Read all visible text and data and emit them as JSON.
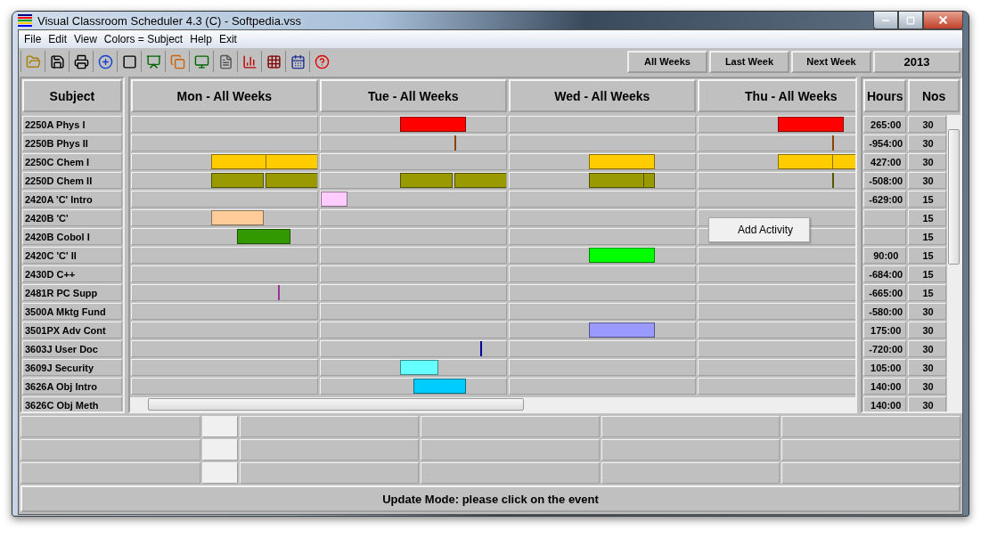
{
  "window": {
    "title": "Visual Classroom Scheduler 4.3 (C) - Softpedia.vss"
  },
  "menu": [
    "File",
    "Edit",
    "View",
    "Colors = Subject",
    "Help",
    "Exit"
  ],
  "week_buttons": [
    "All Weeks",
    "Last Week",
    "Next Week"
  ],
  "year": "2013",
  "columns": {
    "subject": "Subject",
    "hours": "Hours",
    "nos": "Nos"
  },
  "days": [
    "Mon - All Weeks",
    "Tue - All Weeks",
    "Wed - All Weeks",
    "Thu - All Weeks"
  ],
  "subjects": [
    {
      "name": "2250A Phys I",
      "hours": "265:00",
      "nos": "30",
      "activities": [
        {
          "color": "#ff0000"
        },
        {
          "color": "#ff0000"
        }
      ]
    },
    {
      "name": "2250B Phys II",
      "hours": "-954:00",
      "nos": "30",
      "activities": [
        {
          "color": "#884400"
        },
        {
          "color": "#884400"
        }
      ]
    },
    {
      "name": "2250C Chem I",
      "hours": "427:00",
      "nos": "30",
      "activities": [
        {
          "color": "#ffcc00"
        },
        {
          "color": "#ffcc00"
        },
        {
          "color": "#ffcc00"
        },
        {
          "color": "#ffcc00"
        },
        {
          "color": "#ffcc00"
        }
      ]
    },
    {
      "name": "2250D Chem II",
      "hours": "-508:00",
      "nos": "30",
      "activities": [
        {
          "color": "#999900"
        },
        {
          "color": "#999900"
        },
        {
          "color": "#999900"
        },
        {
          "color": "#999900"
        },
        {
          "color": "#999900"
        },
        {
          "color": "#999900"
        },
        {
          "color": "#555500"
        }
      ]
    },
    {
      "name": "2420A 'C' Intro",
      "hours": "-629:00",
      "nos": "15",
      "activities": [
        {
          "color": "#ffccff"
        }
      ]
    },
    {
      "name": "2420B 'C'",
      "nos": "15",
      "activities": [
        {
          "color": "#ffcc99"
        }
      ]
    },
    {
      "name": "2420B Cobol I",
      "nos": "15",
      "activities": [
        {
          "color": "#339900"
        }
      ]
    },
    {
      "name": "2420C 'C' II",
      "hours": "90:00",
      "nos": "15",
      "activities": [
        {
          "color": "#00ff00"
        }
      ]
    },
    {
      "name": "2430D C++",
      "hours": "-684:00",
      "nos": "15"
    },
    {
      "name": "2481R PC Supp",
      "hours": "-665:00",
      "nos": "15",
      "activities": [
        {
          "color": "#993399"
        }
      ]
    },
    {
      "name": "3500A Mktg Fund",
      "hours": "-580:00",
      "nos": "30"
    },
    {
      "name": "3501PX Adv Cont",
      "hours": "175:00",
      "nos": "30",
      "activities": [
        {
          "color": "#9999ff"
        }
      ]
    },
    {
      "name": "3603J User Doc",
      "hours": "-720:00",
      "nos": "30",
      "activities": [
        {
          "color": "#000099"
        }
      ]
    },
    {
      "name": "3609J Security",
      "hours": "105:00",
      "nos": "30",
      "activities": [
        {
          "color": "#66ffff"
        }
      ]
    },
    {
      "name": "3626A Obj Intro",
      "hours": "140:00",
      "nos": "30",
      "activities": [
        {
          "color": "#00ccff"
        }
      ]
    },
    {
      "name": "3626C Obj Meth",
      "hours": "140:00",
      "nos": "30"
    }
  ],
  "context_menu": [
    "Add Activity"
  ],
  "status": "Update Mode: please click on the event"
}
